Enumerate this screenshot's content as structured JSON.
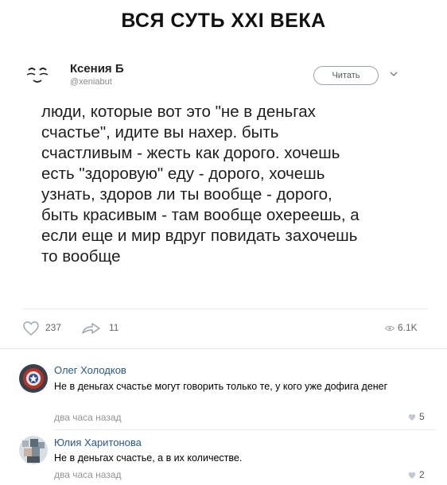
{
  "meme": {
    "title": "ВСЯ СУТЬ XXI ВЕКА"
  },
  "tweet": {
    "author_name": "Ксения Б",
    "author_handle": "@xeniabut",
    "follow_label": "Читать",
    "text": "люди, которые вот это \"не в деньгах\nсчастье\", идите вы нахер. быть\nсчастливым - жесть как дорого. хочешь\nесть \"здоровую\" еду - дорого, хочешь\nузнать, здоров ли ты вообще - дорого,\nбыть красивым - там вообще охереешь, а\nесли еще и мир вдруг повидать захочешь\nто вообще"
  },
  "actions": {
    "likes": "237",
    "reposts": "11",
    "views": "6.1K"
  },
  "comments": [
    {
      "author": "Олег Холодков",
      "text": "Не в деньгах счастье могут говорить только те, у кого уже дофига денег",
      "time": "два часа назад",
      "likes": "5"
    },
    {
      "author": "Юлия Харитонова",
      "text": "Не в деньгах счастье, а в их количестве.",
      "time": "два часа назад",
      "likes": "2"
    }
  ],
  "colors": {
    "link": "#2a5885",
    "muted": "#939393",
    "divider": "#ececec"
  }
}
